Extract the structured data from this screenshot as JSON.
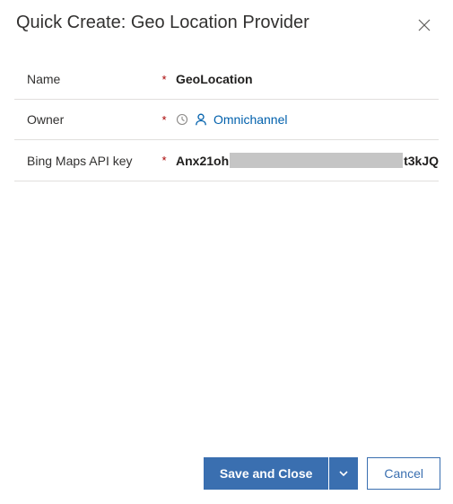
{
  "header": {
    "title": "Quick Create: Geo Location Provider"
  },
  "form": {
    "required_marker": "*",
    "fields": {
      "name": {
        "label": "Name",
        "value": "GeoLocation"
      },
      "owner": {
        "label": "Owner",
        "value": "Omnichannel"
      },
      "api_key": {
        "label": "Bing Maps API key",
        "value_prefix": "Anx21oh",
        "value_suffix": "t3kJQ"
      }
    }
  },
  "footer": {
    "save_label": "Save and Close",
    "cancel_label": "Cancel"
  }
}
